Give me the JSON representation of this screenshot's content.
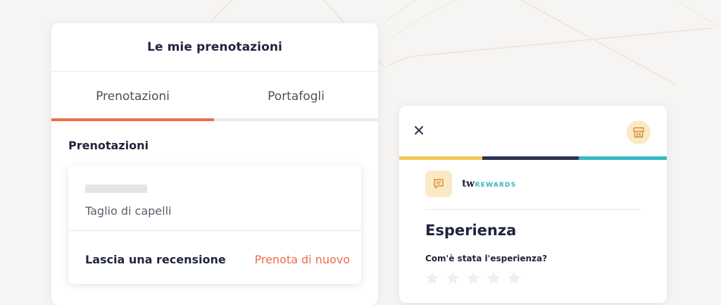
{
  "bookings_screen": {
    "title": "Le mie prenotazioni",
    "tabs": [
      {
        "label": "Prenotazioni",
        "active": true
      },
      {
        "label": "Portafogli",
        "active": false
      }
    ],
    "accent_color": "#f06b47",
    "section_title": "Prenotazioni",
    "booking": {
      "service": "Taglio di capelli",
      "review_action": "Lascia una recensione",
      "rebook_action": "Prenota di nuovo"
    }
  },
  "review_panel": {
    "close_icon": "close-icon",
    "store_icon": "store-icon",
    "progress_colors": [
      "#f5c757",
      "#2e3152",
      "#35b7c2"
    ],
    "brand": {
      "prefix": "tw",
      "name": "REWARDS"
    },
    "badge_icon": "chat-icon",
    "heading": "Esperienza",
    "question": "Com'è stata l'esperienza?",
    "rating": {
      "max": 5,
      "value": 0
    }
  }
}
